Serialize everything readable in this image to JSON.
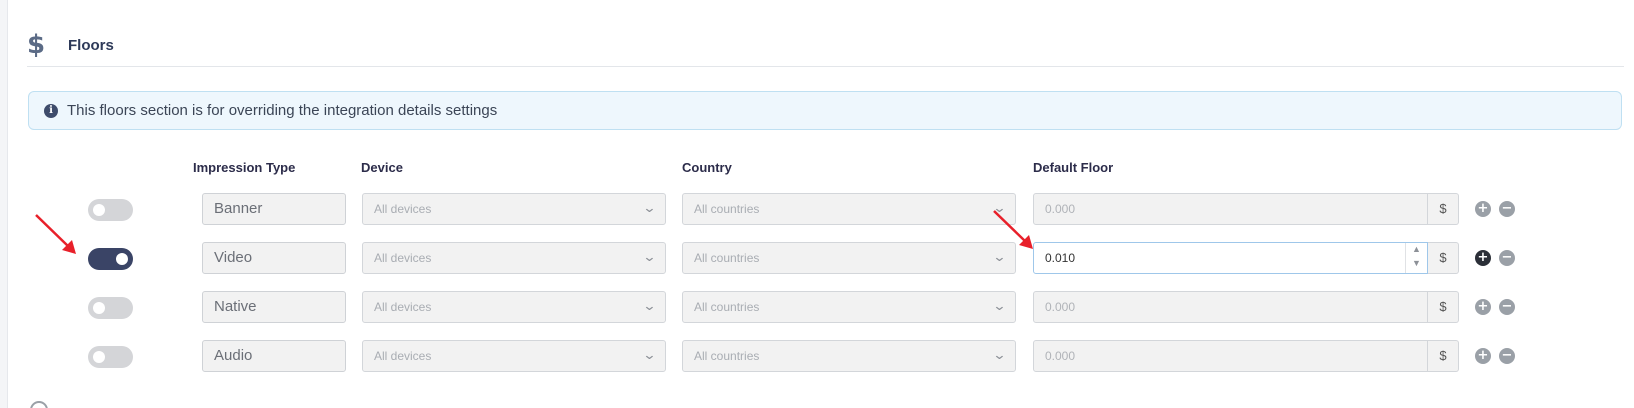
{
  "section": {
    "icon": "dollar-icon",
    "title": "Floors"
  },
  "info": {
    "icon": "info-icon",
    "text": "This floors section is for overriding the integration details settings"
  },
  "columns": {
    "impression_type": "Impression Type",
    "device": "Device",
    "country": "Country",
    "default_floor": "Default Floor"
  },
  "rows": [
    {
      "enabled": false,
      "type": "Banner",
      "device": "All devices",
      "country": "All countries",
      "floor": "0.000",
      "currency": "$"
    },
    {
      "enabled": true,
      "type": "Video",
      "device": "All devices",
      "country": "All countries",
      "floor": "0.010",
      "currency": "$"
    },
    {
      "enabled": false,
      "type": "Native",
      "device": "All devices",
      "country": "All countries",
      "floor": "0.000",
      "currency": "$"
    },
    {
      "enabled": false,
      "type": "Audio",
      "device": "All devices",
      "country": "All countries",
      "floor": "0.000",
      "currency": "$"
    }
  ],
  "colors": {
    "toggle_on": "#3a4466",
    "toggle_off": "#d4d5d8",
    "annotation_arrow": "#e8202a",
    "info_bg": "#eef7fd"
  }
}
